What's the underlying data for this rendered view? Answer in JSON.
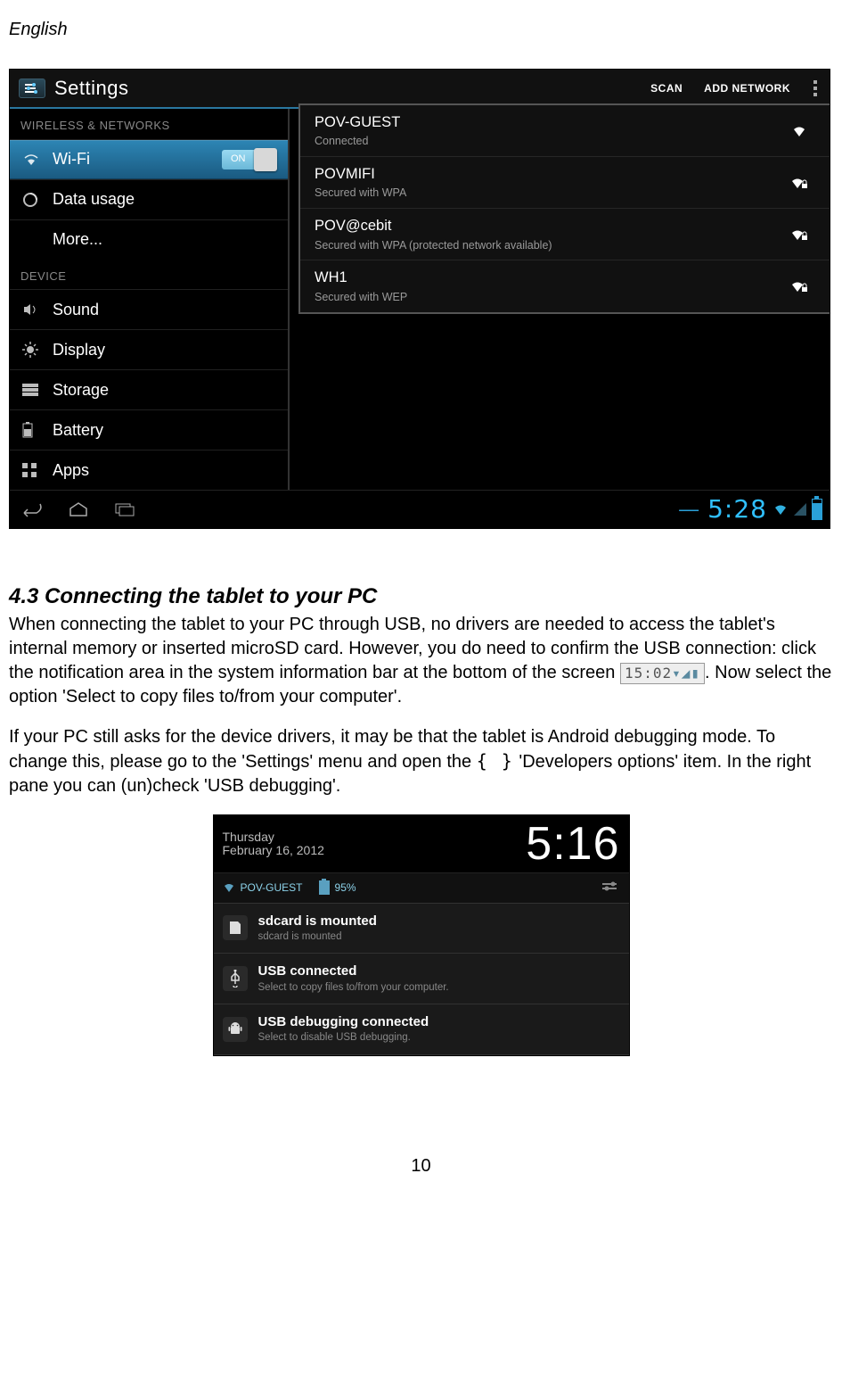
{
  "page": {
    "header_lang": "English",
    "page_number": "10"
  },
  "screenshot1": {
    "title": "Settings",
    "action_scan": "SCAN",
    "action_add": "ADD NETWORK",
    "sections": {
      "wireless_label": "WIRELESS & NETWORKS",
      "device_label": "DEVICE"
    },
    "sidebar": {
      "wifi": "Wi-Fi",
      "wifi_toggle": "ON",
      "data_usage": "Data usage",
      "more": "More...",
      "sound": "Sound",
      "display": "Display",
      "storage": "Storage",
      "battery": "Battery",
      "apps": "Apps"
    },
    "networks": [
      {
        "ssid": "POV-GUEST",
        "sub": "Connected"
      },
      {
        "ssid": "POVMIFI",
        "sub": "Secured with WPA"
      },
      {
        "ssid": "POV@cebit",
        "sub": "Secured with WPA (protected network available)"
      },
      {
        "ssid": "WH1",
        "sub": "Secured with WEP"
      }
    ],
    "nav_clock": "5:28"
  },
  "article": {
    "heading": "4.3 Connecting the tablet to your PC",
    "para1a": "When connecting the tablet to your PC through USB, no drivers are needed to access the tablet's internal memory or inserted microSD card. However, you do need to confirm the USB connection:  click the notification area in the system information bar at the bottom of the screen ",
    "notif_chip": "15:02",
    "para1b": ". Now select the option 'Select to copy files to/from your computer'.",
    "para2a": "If your PC still asks for the device drivers, it may be that the tablet is Android debugging mode. To change this, please go to the 'Settings' menu and open the ",
    "dev_brace": "{ }",
    "para2b": "'Developers options' item. In the right pane you can (un)check 'USB debugging'."
  },
  "screenshot2": {
    "dow": "Thursday",
    "date": "February 16, 2012",
    "clock": "5:16",
    "status_net": "POV-GUEST",
    "status_batt": "95%",
    "notifs": [
      {
        "icon": "sd",
        "title": "sdcard is mounted",
        "sub": "sdcard is mounted"
      },
      {
        "icon": "usb",
        "title": "USB connected",
        "sub": "Select to copy files to/from your computer."
      },
      {
        "icon": "android",
        "title": "USB debugging connected",
        "sub": "Select to disable USB debugging."
      }
    ]
  }
}
